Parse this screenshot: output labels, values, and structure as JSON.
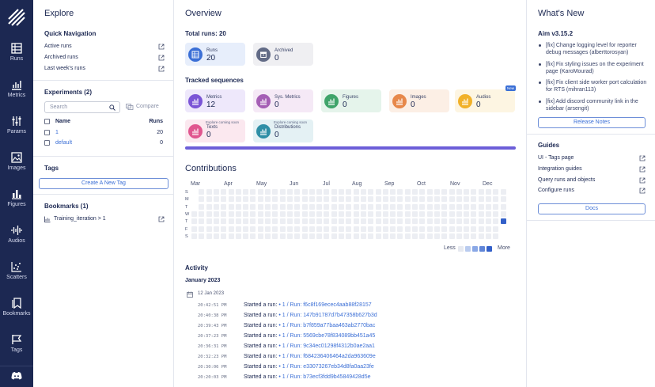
{
  "nav": [
    {
      "label": "Runs",
      "icon": "runs-icon"
    },
    {
      "label": "Metrics",
      "icon": "metrics-icon"
    },
    {
      "label": "Params",
      "icon": "params-icon"
    },
    {
      "label": "Images",
      "icon": "images-icon"
    },
    {
      "label": "Figures",
      "icon": "figures-icon"
    },
    {
      "label": "Audios",
      "icon": "audios-icon"
    },
    {
      "label": "Scatters",
      "icon": "scatters-icon"
    },
    {
      "label": "Bookmarks",
      "icon": "bookmarks-icon"
    },
    {
      "label": "Tags",
      "icon": "tags-icon"
    }
  ],
  "explore": {
    "title": "Explore",
    "quick_nav_title": "Quick Navigation",
    "quick_nav": [
      "Active runs",
      "Archived runs",
      "Last week's runs"
    ],
    "experiments_title": "Experiments (2)",
    "search_placeholder": "Search",
    "compare_label": "Compare",
    "col_name": "Name",
    "col_runs": "Runs",
    "experiments": [
      {
        "name": "1",
        "runs": "20"
      },
      {
        "name": "default",
        "runs": "0"
      }
    ],
    "tags_title": "Tags",
    "create_tag_label": "Create A New Tag",
    "bookmarks_title": "Bookmarks (1)",
    "bookmarks": [
      "Training_iteration > 1"
    ]
  },
  "overview": {
    "title": "Overview",
    "total_runs": "Total runs: 20",
    "run_cards": [
      {
        "label": "Runs",
        "value": "20",
        "color": "#3b6fd6",
        "bg": "#e7eefb"
      },
      {
        "label": "Archived",
        "value": "0",
        "color": "#626b86",
        "bg": "#efeff2"
      }
    ],
    "tracked_title": "Tracked sequences",
    "seq_cards": [
      {
        "label": "Metrics",
        "value": "12",
        "color": "#7b55d6",
        "bg": "#eee8fb",
        "soon": "",
        "new": ""
      },
      {
        "label": "Sys. Metrics",
        "value": "0",
        "color": "#a55fb5",
        "bg": "#f5e9f6",
        "soon": "",
        "new": ""
      },
      {
        "label": "Figures",
        "value": "0",
        "color": "#3fa46a",
        "bg": "#e5f4eb",
        "soon": "",
        "new": ""
      },
      {
        "label": "Images",
        "value": "0",
        "color": "#e7884a",
        "bg": "#fcefe5",
        "soon": "",
        "new": ""
      },
      {
        "label": "Audios",
        "value": "0",
        "color": "#f1b129",
        "bg": "#fdf5e2",
        "soon": "",
        "new": "New"
      },
      {
        "label": "Texts",
        "value": "0",
        "color": "#e0568f",
        "bg": "#fbe8ef",
        "soon": "Explore coming soon",
        "new": ""
      },
      {
        "label": "Distributions",
        "value": "0",
        "color": "#2f8fa6",
        "bg": "#e4f1f4",
        "soon": "Explore coming soon",
        "new": ""
      }
    ],
    "contributions_title": "Contributions",
    "months": [
      "Mar",
      "Apr",
      "May",
      "Jun",
      "Jul",
      "Aug",
      "Sep",
      "Oct",
      "Nov",
      "Dec"
    ],
    "days": [
      "S",
      "M",
      "T",
      "W",
      "T",
      "F",
      "S"
    ],
    "legend_less": "Less",
    "legend_more": "More",
    "activity_title": "Activity",
    "activity_month": "January 2023",
    "activity_date": "12 Jan 2023",
    "activity": [
      {
        "time": "20:42:51 PM",
        "text": "Started a run:",
        "link": "• 1 / Run: f6c8f169ecec4aab88f28157"
      },
      {
        "time": "20:40:38 PM",
        "text": "Started a run:",
        "link": "• 1 / Run: 147b91787d7b47358b627b3d"
      },
      {
        "time": "20:39:43 PM",
        "text": "Started a run:",
        "link": "• 1 / Run: b7f859a77baa463ab2770bac"
      },
      {
        "time": "20:37:23 PM",
        "text": "Started a run:",
        "link": "• 1 / Run: 5569cbe78f834089bb451a45"
      },
      {
        "time": "20:36:31 PM",
        "text": "Started a run:",
        "link": "• 1 / Run: 9c34ec01298f4312b0ae2aa1"
      },
      {
        "time": "20:32:23 PM",
        "text": "Started a run:",
        "link": "• 1 / Run: f684236406464a2da963609e"
      },
      {
        "time": "20:30:06 PM",
        "text": "Started a run:",
        "link": "• 1 / Run: e33073267eb34d8fa0aa23fe"
      },
      {
        "time": "20:20:03 PM",
        "text": "Started a run:",
        "link": "• 1 / Run: b73ecf3fdd9b45849428d5e"
      }
    ]
  },
  "whats_new": {
    "title": "What's New",
    "version": "Aim v3.15.2",
    "items": [
      "[fix] Change logging level for reporter debug messages (alberttorosyan)",
      "[fix] Fix styling issues on the experiment page (KaroMourad)",
      "[fix] Fix client side worker port calculation for RTS (mihran113)",
      "[fix] Add discord community link in the sidebar (arsengit)"
    ],
    "release_notes_label": "Release Notes",
    "guides_title": "Guides",
    "guides": [
      "UI - Tags page",
      "Integration guides",
      "Query runs and objects",
      "Configure runs"
    ],
    "docs_label": "Docs"
  }
}
